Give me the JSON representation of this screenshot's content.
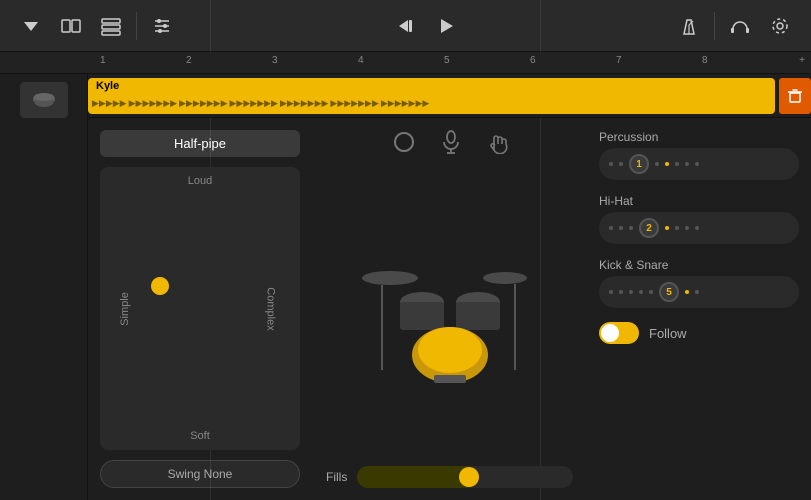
{
  "toolbar": {
    "dropdown_icon": "▼",
    "layout_icons": [
      "▭▭",
      "≡"
    ],
    "mixer_icon": "⚙",
    "rewind_icon": "⏮",
    "play_icon": "▶",
    "metronome_icon": "🎵",
    "headphone_icon": "Ω",
    "settings_icon": "⚙"
  },
  "ruler": {
    "numbers": [
      "1",
      "2",
      "3",
      "4",
      "5",
      "6",
      "7",
      "8"
    ],
    "add_label": "+"
  },
  "track": {
    "name": "Kyle",
    "clip_color": "#f0b800"
  },
  "preset": {
    "label": "Half-pipe"
  },
  "xy_pad": {
    "loud_label": "Loud",
    "soft_label": "Soft",
    "simple_label": "Simple",
    "complex_label": "Complex"
  },
  "swing": {
    "label": "Swing None"
  },
  "drum_icons": [
    {
      "name": "circle-icon",
      "symbol": "○"
    },
    {
      "name": "mic-icon",
      "symbol": "🎤"
    },
    {
      "name": "hand-icon",
      "symbol": "✋"
    }
  ],
  "fills": {
    "label": "Fills"
  },
  "percussion": {
    "section_label": "Percussion",
    "knob_value": "1"
  },
  "hihat": {
    "section_label": "Hi-Hat",
    "knob_value": "2"
  },
  "kick_snare": {
    "section_label": "Kick & Snare",
    "knob_value": "5"
  },
  "follow": {
    "label": "Follow"
  }
}
